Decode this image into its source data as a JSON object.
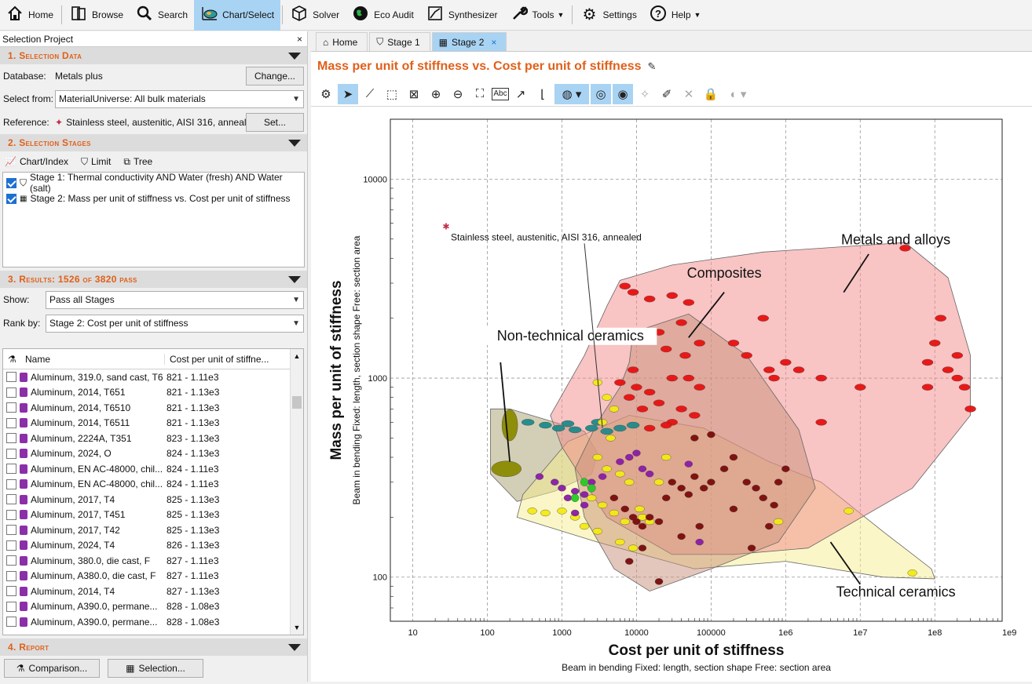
{
  "toolbar": {
    "items": [
      {
        "label": "Home",
        "icon": "home-icon"
      },
      {
        "label": "Browse",
        "icon": "browse-icon"
      },
      {
        "label": "Search",
        "icon": "search-icon"
      },
      {
        "label": "Chart/Select",
        "icon": "chart-select-icon"
      },
      {
        "label": "Solver",
        "icon": "solver-icon"
      },
      {
        "label": "Eco Audit",
        "icon": "eco-audit-icon"
      },
      {
        "label": "Synthesizer",
        "icon": "synthesizer-icon"
      },
      {
        "label": "Tools",
        "icon": "tools-icon"
      },
      {
        "label": "Settings",
        "icon": "gear-icon"
      },
      {
        "label": "Help",
        "icon": "help-icon"
      }
    ],
    "active": "Chart/Select"
  },
  "left": {
    "project_title": "Selection Project",
    "close": "×",
    "section1": "1. Selection Data",
    "database_label": "Database:",
    "database_value": "Metals plus",
    "change_btn": "Change...",
    "select_from_label": "Select from:",
    "select_from_value": "MaterialUniverse: All bulk materials",
    "reference_label": "Reference:",
    "reference_value": "Stainless steel, austenitic, AISI 316, anneale",
    "set_btn": "Set...",
    "section2": "2. Selection Stages",
    "stage_tools": [
      "Chart/Index",
      "Limit",
      "Tree"
    ],
    "stages": [
      "Stage 1: Thermal conductivity AND Water (fresh) AND Water (salt)",
      "Stage 2: Mass per unit of stiffness vs. Cost per unit of stiffness"
    ],
    "section3": "3. Results: 1526 of 3820 pass",
    "show_label": "Show:",
    "show_value": "Pass all Stages",
    "rank_label": "Rank by:",
    "rank_value": "Stage 2: Cost per unit of stiffness",
    "col_name": "Name",
    "col_cost": "Cost per unit of stiffne...",
    "results": [
      {
        "name": "Aluminum, 319.0, sand cast, T6",
        "range": "821 - 1.11e3"
      },
      {
        "name": "Aluminum, 2014, T651",
        "range": "821 - 1.13e3"
      },
      {
        "name": "Aluminum, 2014, T6510",
        "range": "821 - 1.13e3"
      },
      {
        "name": "Aluminum, 2014, T6511",
        "range": "821 - 1.13e3"
      },
      {
        "name": "Aluminum, 2224A, T351",
        "range": "823 - 1.13e3"
      },
      {
        "name": "Aluminum, 2024, O",
        "range": "824 - 1.13e3"
      },
      {
        "name": "Aluminum, EN AC-48000, chil...",
        "range": "824 - 1.11e3"
      },
      {
        "name": "Aluminum, EN AC-48000, chil...",
        "range": "824 - 1.11e3"
      },
      {
        "name": "Aluminum, 2017, T4",
        "range": "825 - 1.13e3"
      },
      {
        "name": "Aluminum, 2017, T451",
        "range": "825 - 1.13e3"
      },
      {
        "name": "Aluminum, 2017, T42",
        "range": "825 - 1.13e3"
      },
      {
        "name": "Aluminum, 2024, T4",
        "range": "826 - 1.13e3"
      },
      {
        "name": "Aluminum, 380.0, die cast, F",
        "range": "827 - 1.11e3"
      },
      {
        "name": "Aluminum, A380.0, die cast, F",
        "range": "827 - 1.11e3"
      },
      {
        "name": "Aluminum, 2014, T4",
        "range": "827 - 1.13e3"
      },
      {
        "name": "Aluminum, A390.0, permane...",
        "range": "828 - 1.08e3"
      },
      {
        "name": "Aluminum, A390.0, permane...",
        "range": "828 - 1.08e3"
      }
    ],
    "section4": "4. Report",
    "comparison_btn": "Comparison...",
    "selection_btn": "Selection..."
  },
  "right": {
    "tabs": [
      "Home",
      "Stage 1",
      "Stage 2"
    ],
    "active_tab": "Stage 2",
    "tab_close": "×",
    "title": "Mass per unit of stiffness vs. Cost per unit of stiffness"
  },
  "chart_data": {
    "type": "scatter",
    "x_scale": "log",
    "y_scale": "log",
    "xlabel": "Cost per unit of stiffness",
    "x_sub_labels": [
      "Beam in bending",
      "Fixed: length, section shape",
      "Free: section area"
    ],
    "ylabel": "Mass per unit of stiffness",
    "y_sub_labels": [
      "Beam in bending",
      "Fixed: length, section shape",
      "Free: section area"
    ],
    "xlim": [
      5,
      800000000
    ],
    "ylim": [
      60,
      20000
    ],
    "x_ticks": [
      {
        "v": 10,
        "t": "10"
      },
      {
        "v": 100,
        "t": "100"
      },
      {
        "v": 1000,
        "t": "1000"
      },
      {
        "v": 10000,
        "t": "10000"
      },
      {
        "v": 100000,
        "t": "100000"
      },
      {
        "v": 1000000,
        "t": "1e6"
      },
      {
        "v": 10000000,
        "t": "1e7"
      },
      {
        "v": 100000000,
        "t": "1e8"
      },
      {
        "v": 1000000000,
        "t": "1e9"
      }
    ],
    "y_ticks": [
      {
        "v": 100,
        "t": "100"
      },
      {
        "v": 1000,
        "t": "1000"
      },
      {
        "v": 10000,
        "t": "10000"
      }
    ],
    "grid": true,
    "reference_point": {
      "x": 28,
      "y": 5800,
      "label": "Stainless steel, austenitic, AISI 316, annealed"
    },
    "families": [
      {
        "name": "Metals and alloys",
        "color": "#f28a8a"
      },
      {
        "name": "Composites",
        "color": "#c8907a"
      },
      {
        "name": "Non-technical ceramics",
        "color": "#a8a070"
      },
      {
        "name": "Technical ceramics",
        "color": "#f6ee90"
      }
    ],
    "series": [
      {
        "name": "metals",
        "color": "#e81010",
        "points": [
          [
            7000,
            2900
          ],
          [
            9000,
            2700
          ],
          [
            15000,
            2500
          ],
          [
            30000,
            2600
          ],
          [
            50000,
            2400
          ],
          [
            20000,
            1700
          ],
          [
            40000,
            1900
          ],
          [
            25000,
            1400
          ],
          [
            45000,
            1300
          ],
          [
            70000,
            1500
          ],
          [
            30000,
            1000
          ],
          [
            50000,
            1000
          ],
          [
            70000,
            900
          ],
          [
            10000,
            900
          ],
          [
            15000,
            850
          ],
          [
            20000,
            750
          ],
          [
            40000,
            700
          ],
          [
            8000,
            800
          ],
          [
            12000,
            700
          ],
          [
            30000,
            600
          ],
          [
            60000,
            650
          ],
          [
            15000,
            560
          ],
          [
            25000,
            580
          ],
          [
            6000,
            950
          ],
          [
            9000,
            1100
          ],
          [
            200000,
            1500
          ],
          [
            300000,
            1300
          ],
          [
            500000,
            2000
          ],
          [
            600000,
            1100
          ],
          [
            700000,
            1000
          ],
          [
            1000000,
            1200
          ],
          [
            1500000,
            1100
          ],
          [
            3000000,
            1000
          ],
          [
            80000000,
            1200
          ],
          [
            100000000,
            1500
          ],
          [
            120000000,
            2000
          ],
          [
            150000000,
            1100
          ],
          [
            200000000,
            1000
          ],
          [
            250000000,
            900
          ],
          [
            40000000,
            4500
          ],
          [
            3000000,
            600
          ],
          [
            10000000,
            900
          ],
          [
            80000000,
            900
          ],
          [
            200000000,
            1300
          ],
          [
            300000000,
            700
          ]
        ]
      },
      {
        "name": "teal",
        "color": "#1e8a8a",
        "points": [
          [
            350,
            600
          ],
          [
            600,
            580
          ],
          [
            900,
            560
          ],
          [
            1500,
            550
          ],
          [
            2500,
            560
          ],
          [
            4000,
            540
          ],
          [
            6000,
            560
          ],
          [
            9000,
            580
          ],
          [
            1200,
            590
          ],
          [
            3000,
            600
          ]
        ]
      },
      {
        "name": "yellow",
        "color": "#f2ea14",
        "points": [
          [
            3000,
            950
          ],
          [
            4000,
            800
          ],
          [
            5000,
            700
          ],
          [
            3500,
            600
          ],
          [
            4500,
            500
          ],
          [
            3000,
            400
          ],
          [
            4000,
            350
          ],
          [
            6000,
            330
          ],
          [
            8000,
            300
          ],
          [
            2500,
            250
          ],
          [
            3500,
            230
          ],
          [
            5000,
            210
          ],
          [
            7000,
            190
          ],
          [
            6000,
            150
          ],
          [
            9000,
            140
          ],
          [
            12000,
            200
          ],
          [
            15000,
            190
          ],
          [
            20000,
            300
          ],
          [
            25000,
            400
          ],
          [
            400,
            215
          ],
          [
            600,
            210
          ],
          [
            1000,
            215
          ],
          [
            1500,
            200
          ],
          [
            2000,
            180
          ],
          [
            3000,
            170
          ],
          [
            11000,
            220
          ],
          [
            50000000,
            105
          ],
          [
            7000000,
            215
          ],
          [
            800000,
            190
          ]
        ]
      },
      {
        "name": "purple",
        "color": "#8a1aa8",
        "points": [
          [
            500,
            320
          ],
          [
            800,
            300
          ],
          [
            1000,
            280
          ],
          [
            1500,
            270
          ],
          [
            2000,
            260
          ],
          [
            1200,
            250
          ],
          [
            2500,
            300
          ],
          [
            3500,
            320
          ],
          [
            6000,
            380
          ],
          [
            8000,
            400
          ],
          [
            10000,
            420
          ],
          [
            12000,
            350
          ],
          [
            15000,
            330
          ],
          [
            50000,
            370
          ],
          [
            70000,
            150
          ],
          [
            1500,
            210
          ],
          [
            2000,
            230
          ]
        ]
      },
      {
        "name": "dark-red",
        "color": "#7a0a0a",
        "points": [
          [
            5000,
            250
          ],
          [
            7000,
            220
          ],
          [
            9000,
            200
          ],
          [
            10000,
            190
          ],
          [
            12000,
            180
          ],
          [
            15000,
            200
          ],
          [
            20000,
            190
          ],
          [
            25000,
            250
          ],
          [
            30000,
            300
          ],
          [
            40000,
            280
          ],
          [
            50000,
            260
          ],
          [
            60000,
            320
          ],
          [
            80000,
            280
          ],
          [
            100000,
            300
          ],
          [
            150000,
            350
          ],
          [
            200000,
            400
          ],
          [
            300000,
            300
          ],
          [
            400000,
            280
          ],
          [
            500000,
            250
          ],
          [
            600000,
            180
          ],
          [
            700000,
            230
          ],
          [
            800000,
            300
          ],
          [
            1000000,
            350
          ],
          [
            20000,
            95
          ],
          [
            8000,
            120
          ],
          [
            12000,
            140
          ],
          [
            40000,
            160
          ],
          [
            70000,
            180
          ],
          [
            200000,
            220
          ],
          [
            350000,
            140
          ],
          [
            60000,
            500
          ],
          [
            100000,
            520
          ]
        ]
      },
      {
        "name": "green",
        "color": "#22cc22",
        "points": [
          [
            2000,
            300
          ],
          [
            2500,
            280
          ],
          [
            1500,
            250
          ]
        ]
      },
      {
        "name": "olive",
        "color": "#8a8a00",
        "points": [
          [
            200,
            580
          ],
          [
            180,
            350
          ]
        ]
      }
    ],
    "annotations": [
      {
        "text": "Metals and alloys",
        "x": 30000000,
        "y": 4000
      },
      {
        "text": "Composites",
        "x": 150000,
        "y": 2700
      },
      {
        "text": "Non-technical ceramics",
        "x": 20,
        "y": 1350
      },
      {
        "text": "Technical ceramics",
        "x": 10000000,
        "y": 80
      }
    ]
  }
}
